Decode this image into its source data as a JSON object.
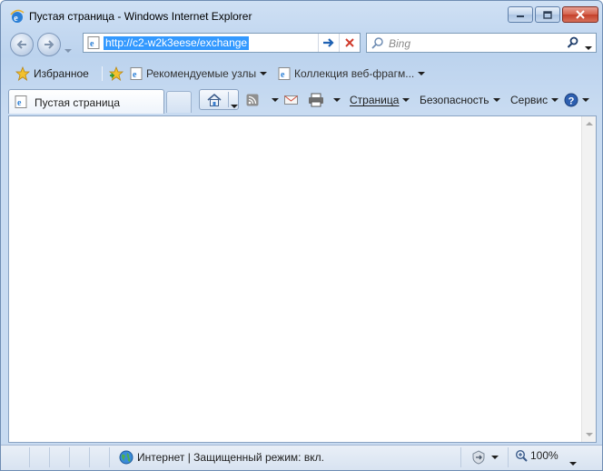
{
  "window": {
    "title": "Пустая страница - Windows Internet Explorer"
  },
  "nav": {
    "address": "http://c2-w2k3eese/exchange",
    "search_placeholder": "Bing"
  },
  "favorites": {
    "favorites_label": "Избранное",
    "suggested_sites_label": "Рекомендуемые узлы",
    "web_slice_label": "Коллекция веб-фрагм..."
  },
  "tabs": [
    {
      "label": "Пустая страница"
    }
  ],
  "command_bar": {
    "page_label": "Страница",
    "safety_label": "Безопасность",
    "tools_label": "Сервис"
  },
  "status": {
    "zone_text": "Интернет | Защищенный режим: вкл.",
    "zoom": "100%"
  },
  "colors": {
    "selection": "#3399ff",
    "close_button": "#c4402a",
    "chrome_blue": "#cfe0f4"
  }
}
